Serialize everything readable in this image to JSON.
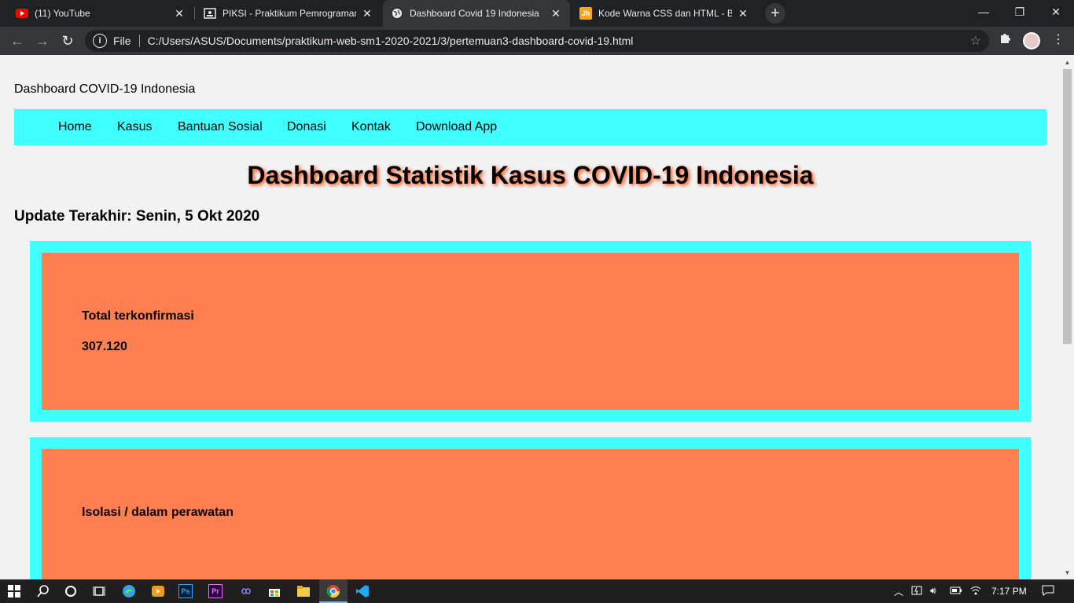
{
  "browser": {
    "tabs": [
      {
        "title": "(11) YouTube",
        "icon": "youtube-icon",
        "active": false
      },
      {
        "title": "PIKSI - Praktikum Pemrograman W",
        "icon": "portrait-icon",
        "active": false
      },
      {
        "title": "Dashboard Covid 19 Indonesia",
        "icon": "globe-icon",
        "active": true
      },
      {
        "title": "Kode Warna CSS dan HTML - Blo",
        "icon": "jh-icon",
        "active": false
      }
    ],
    "new_tab": "+",
    "file_label": "File",
    "url": "C:/Users/ASUS/Documents/praktikum-web-sm1-2020-2021/3/pertemuan3-dashboard-covid-19.html",
    "jh_favicon_text": "Jh"
  },
  "page": {
    "site_title": "Dashboard COVID-19 Indonesia",
    "nav": [
      "Home",
      "Kasus",
      "Bantuan Sosial",
      "Donasi",
      "Kontak",
      "Download App"
    ],
    "heading": "Dashboard Statistik Kasus COVID-19 Indonesia",
    "update": "Update Terakhir: Senin, 5 Okt 2020",
    "cards": [
      {
        "label": "Total terkonfirmasi",
        "value": "307.120"
      },
      {
        "label": "Isolasi / dalam perawatan",
        "value": ""
      }
    ],
    "colors": {
      "nav_bg": "#3fffff",
      "card_outer": "#3fffff",
      "card_inner": "#ff7f50",
      "heading_shadow": "#ff4500"
    }
  },
  "taskbar": {
    "clock": "7:17 PM",
    "ps_label": "Ps",
    "pr_label": "Pr"
  }
}
